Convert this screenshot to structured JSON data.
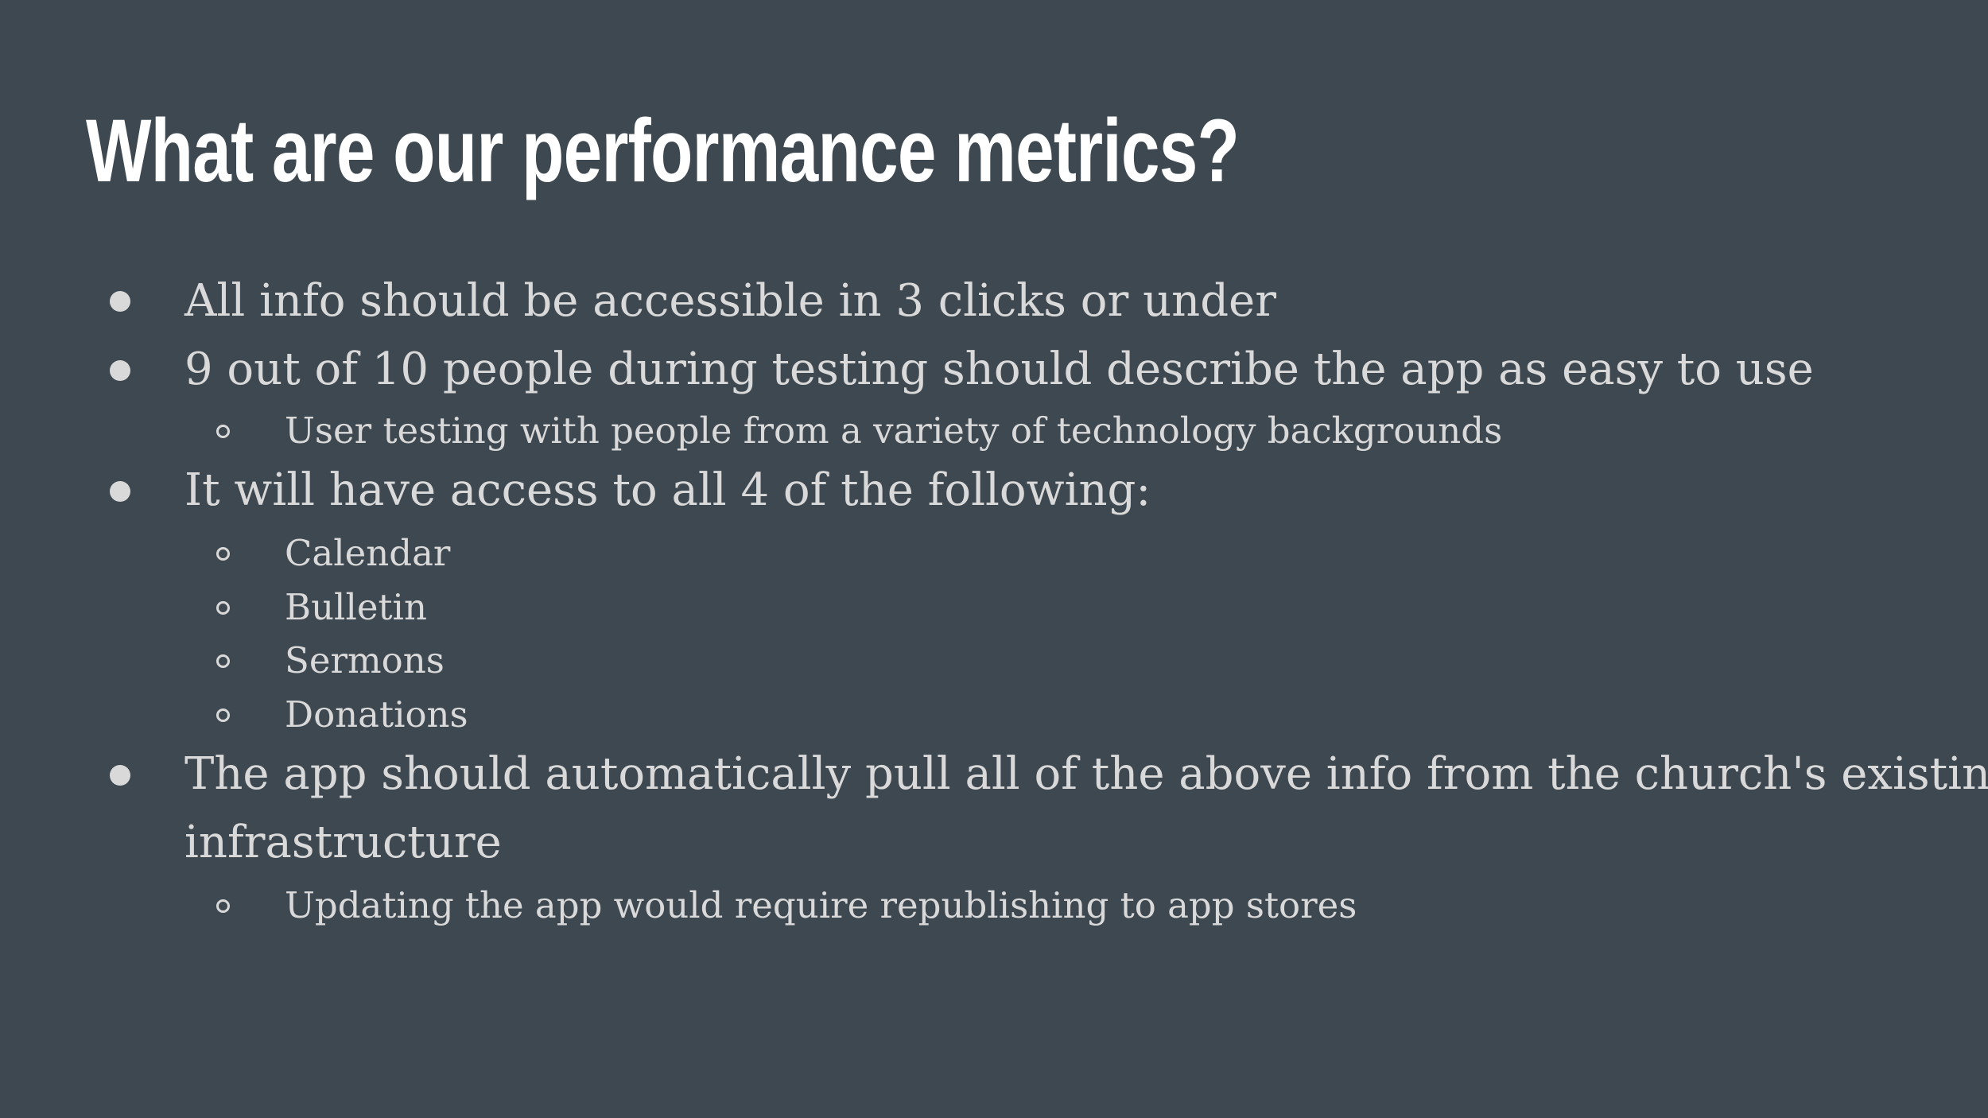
{
  "slide": {
    "title": "What are our performance metrics?",
    "bullets": [
      {
        "text": "All info should be accessible in 3 clicks or under"
      },
      {
        "text": "9 out of 10 people during testing should describe the app as easy to use",
        "sub": [
          "User testing with people from a variety of technology backgrounds"
        ]
      },
      {
        "text": "It will have access to all 4 of the following:",
        "sub": [
          "Calendar",
          "Bulletin",
          "Sermons",
          "Donations"
        ]
      },
      {
        "text_line1": "The app should automatically pull all of the above info from the church's existing",
        "text_line2": "infrastructure",
        "sub": [
          "Updating the app would require republishing to app stores"
        ]
      }
    ]
  },
  "icons": {
    "level1_bullet": "filled-circle-bullet-icon",
    "level2_bullet": "hollow-circle-bullet-icon"
  },
  "colors": {
    "background": "#3e4850",
    "title": "#ffffff",
    "body_text": "#d9d9d9"
  }
}
